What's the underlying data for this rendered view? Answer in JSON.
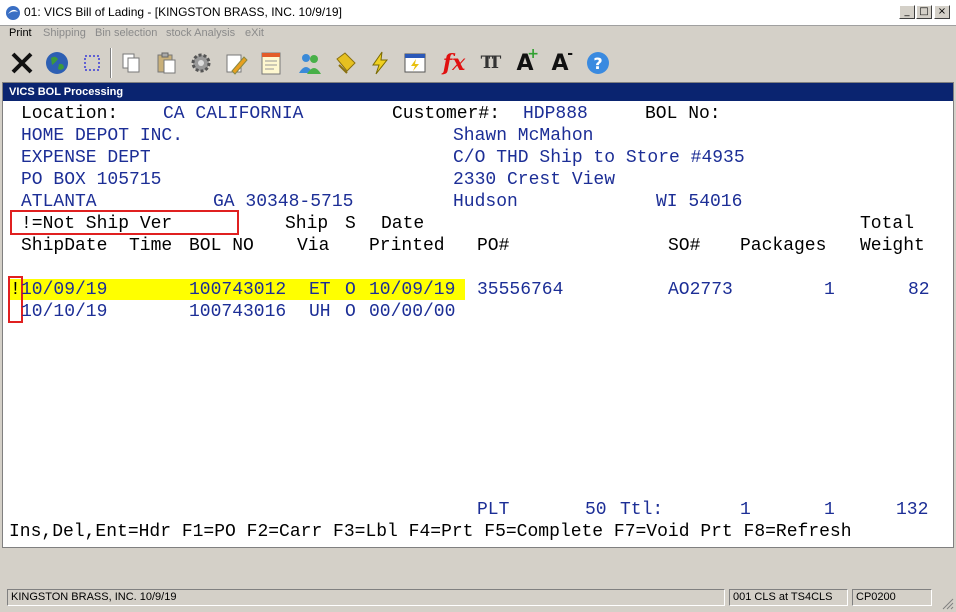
{
  "window": {
    "title": "01: VICS Bill of Lading - [KINGSTON BRASS, INC. 10/9/19]",
    "buttons": {
      "minimize": "_",
      "maximize": "□",
      "close": "×"
    }
  },
  "menu": {
    "items": [
      {
        "label": "Print",
        "enabled": true
      },
      {
        "label": "Shipping",
        "enabled": false
      },
      {
        "label": "Bin selection",
        "enabled": false
      },
      {
        "label": "stock Analysis",
        "enabled": false
      },
      {
        "label": "eXit",
        "enabled": false
      }
    ]
  },
  "toolbar": {
    "icons": [
      "exit-x-icon",
      "globe-icon",
      "select-rect-icon",
      "copy-icon",
      "paste-icon",
      "settings-gear-icon",
      "edit-pencil-icon",
      "notepad-icon",
      "users-icon",
      "tag-icon",
      "lightning-icon",
      "window-lightning-icon",
      "function-fx-icon",
      "text-format-icon",
      "font-increase-icon",
      "font-decrease-icon",
      "help-icon"
    ],
    "fx": "fx",
    "tt": "TT",
    "a": "A",
    "plus": "+",
    "minus": "-",
    "help": "?"
  },
  "panel": {
    "title": "VICS BOL Processing",
    "header": {
      "location_label": "Location:",
      "location_value": "CA CALIFORNIA",
      "customer_label": "Customer#:",
      "customer_value": "HDP888",
      "bol_label": "BOL No:",
      "bill_to": {
        "name": "HOME DEPOT INC.",
        "line2": "EXPENSE DEPT",
        "line3": "PO BOX 105715",
        "city": "ATLANTA",
        "state_zip": "GA 30348-5715"
      },
      "ship_to": {
        "name": "Shawn McMahon",
        "line2": "C/O THD Ship to Store #4935",
        "line3": "2330 Crest View",
        "city": "Hudson",
        "state_zip": "WI 54016"
      }
    },
    "legend": "!=Not Ship Ver",
    "columns": {
      "ship_top": "Ship",
      "s_top": "S",
      "date_top": "Date",
      "total_top": "Total",
      "shipdate": "ShipDate",
      "time": "Time",
      "bol_no": "BOL NO",
      "via": "Via",
      "printed": "Printed",
      "po": "PO#",
      "so": "SO#",
      "packages": "Packages",
      "weight": "Weight"
    },
    "rows": [
      {
        "flag": "!",
        "shipdate": "10/09/19",
        "bol": "100743012",
        "via": "ET",
        "status": "O",
        "printed": "10/09/19",
        "po": "35556764",
        "so": "AO2773",
        "packages": "1",
        "weight": "82",
        "selected": true
      },
      {
        "flag": "",
        "shipdate": "10/10/19",
        "bol": "100743016",
        "via": "UH",
        "status": "O",
        "printed": "00/00/00",
        "po": "",
        "so": "",
        "packages": "",
        "weight": "",
        "selected": false
      }
    ],
    "totals": {
      "plt_label": "PLT",
      "plt_value": "50",
      "ttl_label": "Ttl:",
      "count_a": "1",
      "count_b": "1",
      "weight": "132"
    },
    "keys": "Ins,Del,Ent=Hdr F1=PO F2=Carr F3=Lbl F4=Prt F5=Complete F7=Void Prt F8=Refresh"
  },
  "status": {
    "company": "KINGSTON BRASS, INC. 10/9/19",
    "session": "001 CLS at TS4CLS",
    "program": "CP0200"
  },
  "colors": {
    "panel_title_bg": "#0a2470",
    "text_blue": "#1c2e96",
    "highlight": "#ffff00",
    "annotation": "#e02020"
  }
}
